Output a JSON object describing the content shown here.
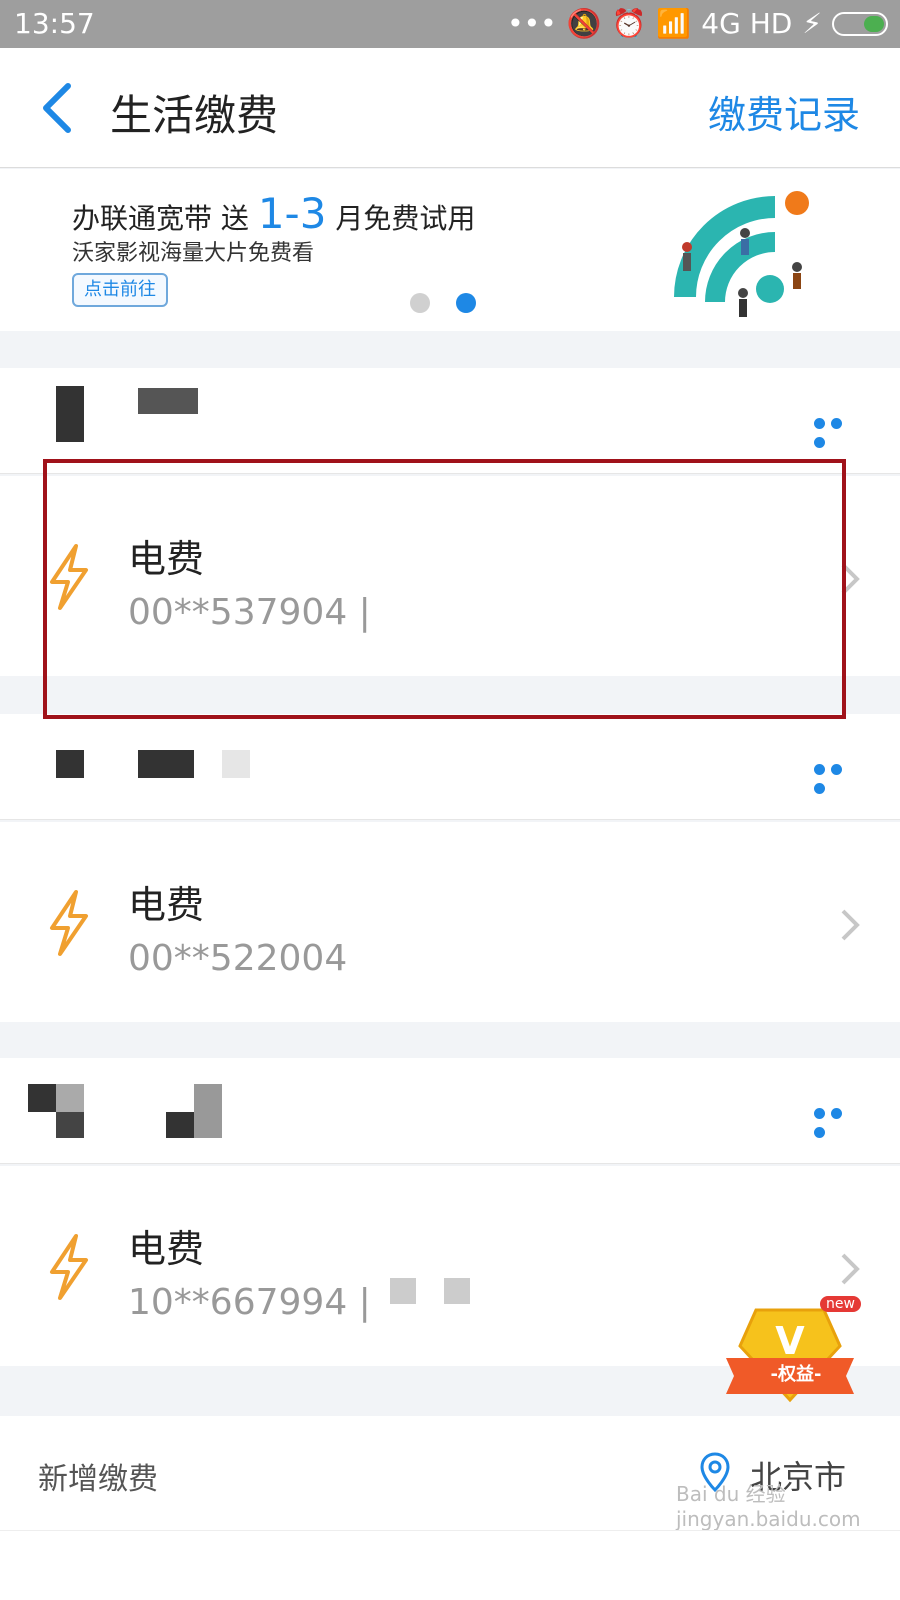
{
  "status_bar": {
    "time": "13:57",
    "signal_text": "4G HD"
  },
  "header": {
    "title": "生活缴费",
    "record_link": "缴费记录"
  },
  "banner": {
    "line1_prefix": "办联通宽带 送",
    "line1_highlight": "1-3",
    "line1_suffix": "月免费试用",
    "line2": "沃家影视海量大片免费看",
    "button": "点击前往",
    "active_slide": 2,
    "slide_count": 2
  },
  "bills": [
    {
      "name": "电费",
      "account": "00**537904 |"
    },
    {
      "name": "电费",
      "account": "00**522004"
    },
    {
      "name": "电费",
      "account": "10**667994 |"
    }
  ],
  "add_payment": {
    "label": "新增缴费",
    "city": "北京市"
  },
  "floating_badge": {
    "label": "-权益-",
    "new_tag": "new"
  },
  "watermark": "Bai du 经验 jingyan.baidu.com",
  "colors": {
    "accent": "#1e88e5",
    "bolt": "#f0a030",
    "highlight_border": "#a0121a"
  }
}
